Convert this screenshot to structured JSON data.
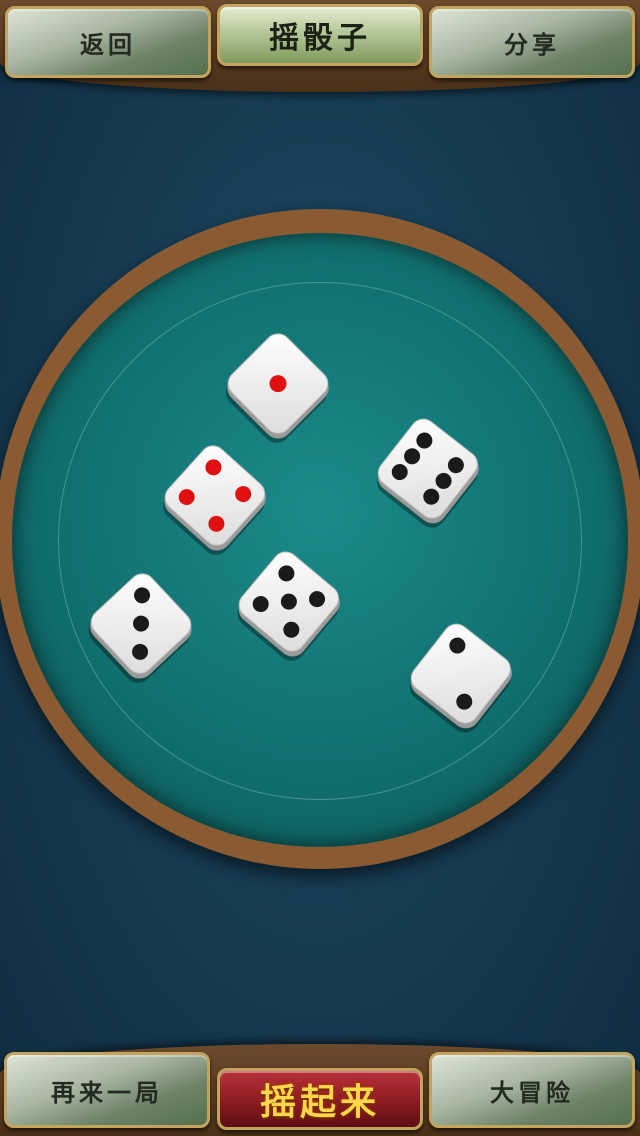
{
  "header": {
    "back_label": "返回",
    "title": "摇骰子",
    "share_label": "分享"
  },
  "footer": {
    "again_label": "再来一局",
    "shake_label": "摇起来",
    "adventure_label": "大冒险"
  },
  "dice": [
    {
      "value": 1,
      "pip_color": "#e01010"
    },
    {
      "value": 6,
      "pip_color": "#1a1a1a"
    },
    {
      "value": 4,
      "pip_color": "#e01010"
    },
    {
      "value": 5,
      "pip_color": "#1a1a1a"
    },
    {
      "value": 3,
      "pip_color": "#1a1a1a"
    },
    {
      "value": 2,
      "pip_color": "#1a1a1a"
    }
  ],
  "colors": {
    "table": "#173d55",
    "felt": "#11706f",
    "wood": "#8a5b33",
    "button_gold": "#c2a45e"
  }
}
